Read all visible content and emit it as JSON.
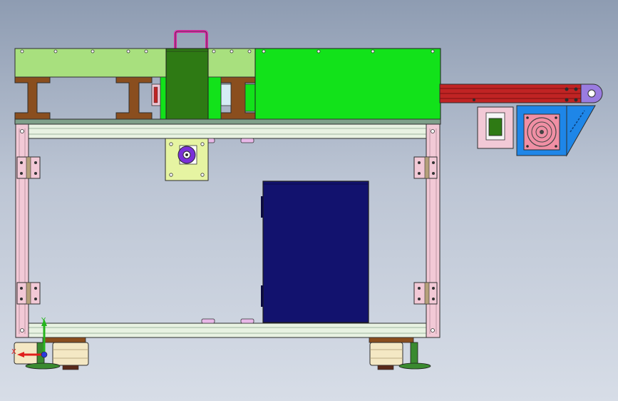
{
  "viewport": {
    "background_top": "#8e9cb2",
    "background_bottom": "#d7dde7"
  },
  "triad": {
    "x_label": "X",
    "y_label": "Y",
    "x_color": "#e0201c",
    "y_color": "#26b51e",
    "z_color": "#2a3adc"
  },
  "colors": {
    "top_plate": "#a8e07e",
    "green_block": "#12e21a",
    "dark_green": "#2e7a14",
    "i_beam": "#8a4e1e",
    "frame_pink": "#f2c9d6",
    "frame_rail": "#e8f2e2",
    "control_box": "#12126e",
    "belt_red": "#c02424",
    "motor_blue": "#1e86e8",
    "fan_pink": "#f08fa4",
    "mount_plate": "#e6f4a2",
    "purple": "#7a30d8"
  }
}
